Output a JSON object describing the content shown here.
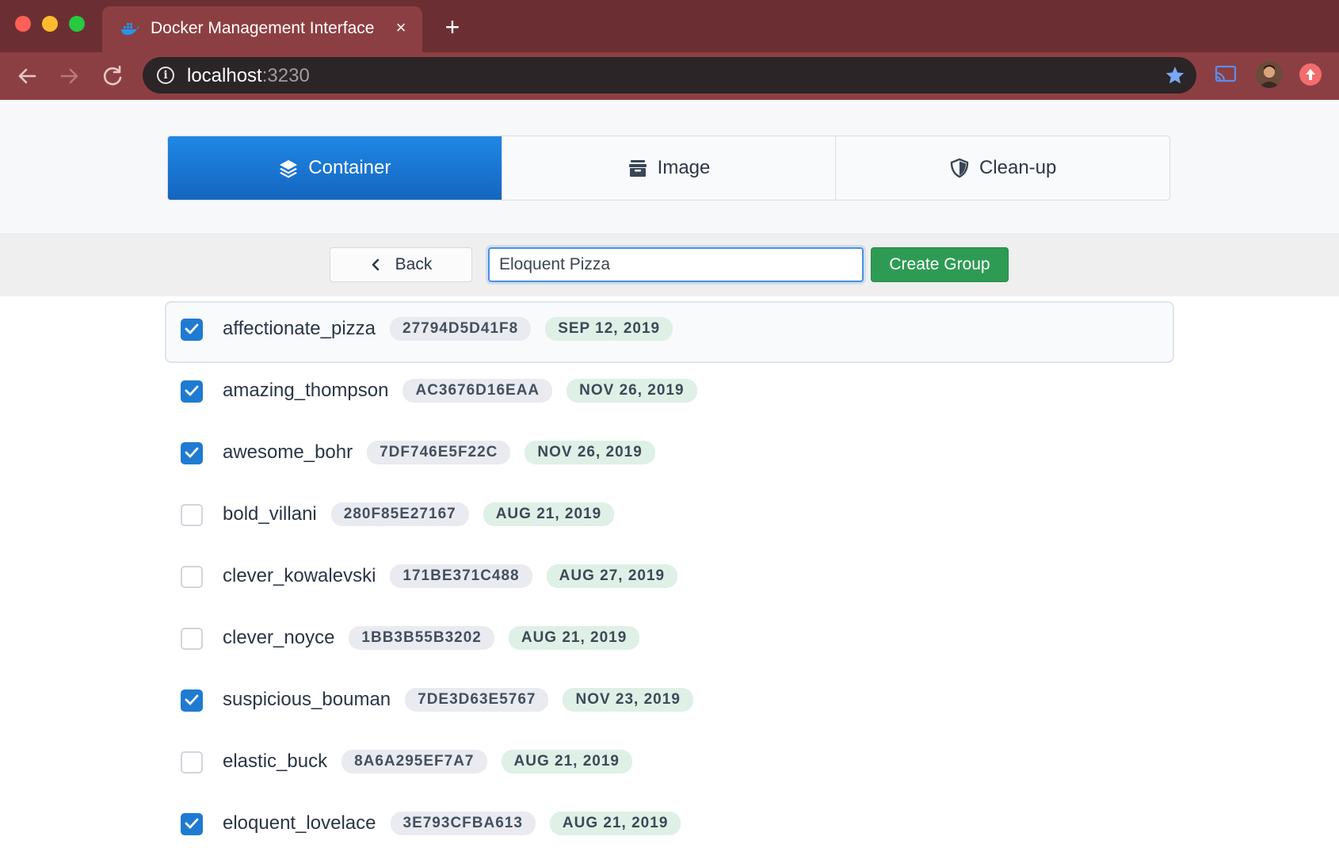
{
  "browser": {
    "tab_title": "Docker Management Interface",
    "new_tab_label": "+",
    "close_tab_label": "×",
    "url_host": "localhost",
    "url_port": ":3230"
  },
  "nav": {
    "tabs": [
      {
        "label": "Container",
        "active": true
      },
      {
        "label": "Image",
        "active": false
      },
      {
        "label": "Clean-up",
        "active": false
      }
    ]
  },
  "actions": {
    "back_label": "Back",
    "group_name_value": "Eloquent Pizza",
    "create_group_label": "Create Group"
  },
  "containers": [
    {
      "name": "affectionate_pizza",
      "id": "27794D5D41F8",
      "date": "SEP 12, 2019",
      "checked": true
    },
    {
      "name": "amazing_thompson",
      "id": "AC3676D16EAA",
      "date": "NOV 26, 2019",
      "checked": true
    },
    {
      "name": "awesome_bohr",
      "id": "7DF746E5F22C",
      "date": "NOV 26, 2019",
      "checked": true
    },
    {
      "name": "bold_villani",
      "id": "280F85E27167",
      "date": "AUG 21, 2019",
      "checked": false
    },
    {
      "name": "clever_kowalevski",
      "id": "171BE371C488",
      "date": "AUG 27, 2019",
      "checked": false
    },
    {
      "name": "clever_noyce",
      "id": "1BB3B55B3202",
      "date": "AUG 21, 2019",
      "checked": false
    },
    {
      "name": "suspicious_bouman",
      "id": "7DE3D63E5767",
      "date": "NOV 23, 2019",
      "checked": true
    },
    {
      "name": "elastic_buck",
      "id": "8A6A295EF7A7",
      "date": "AUG 21, 2019",
      "checked": false
    },
    {
      "name": "eloquent_lovelace",
      "id": "3E793CFBA613",
      "date": "AUG 21, 2019",
      "checked": true
    }
  ],
  "colors": {
    "accent": "#1e88e5",
    "success": "#2e9b54",
    "chrome": "#8c3f42"
  }
}
